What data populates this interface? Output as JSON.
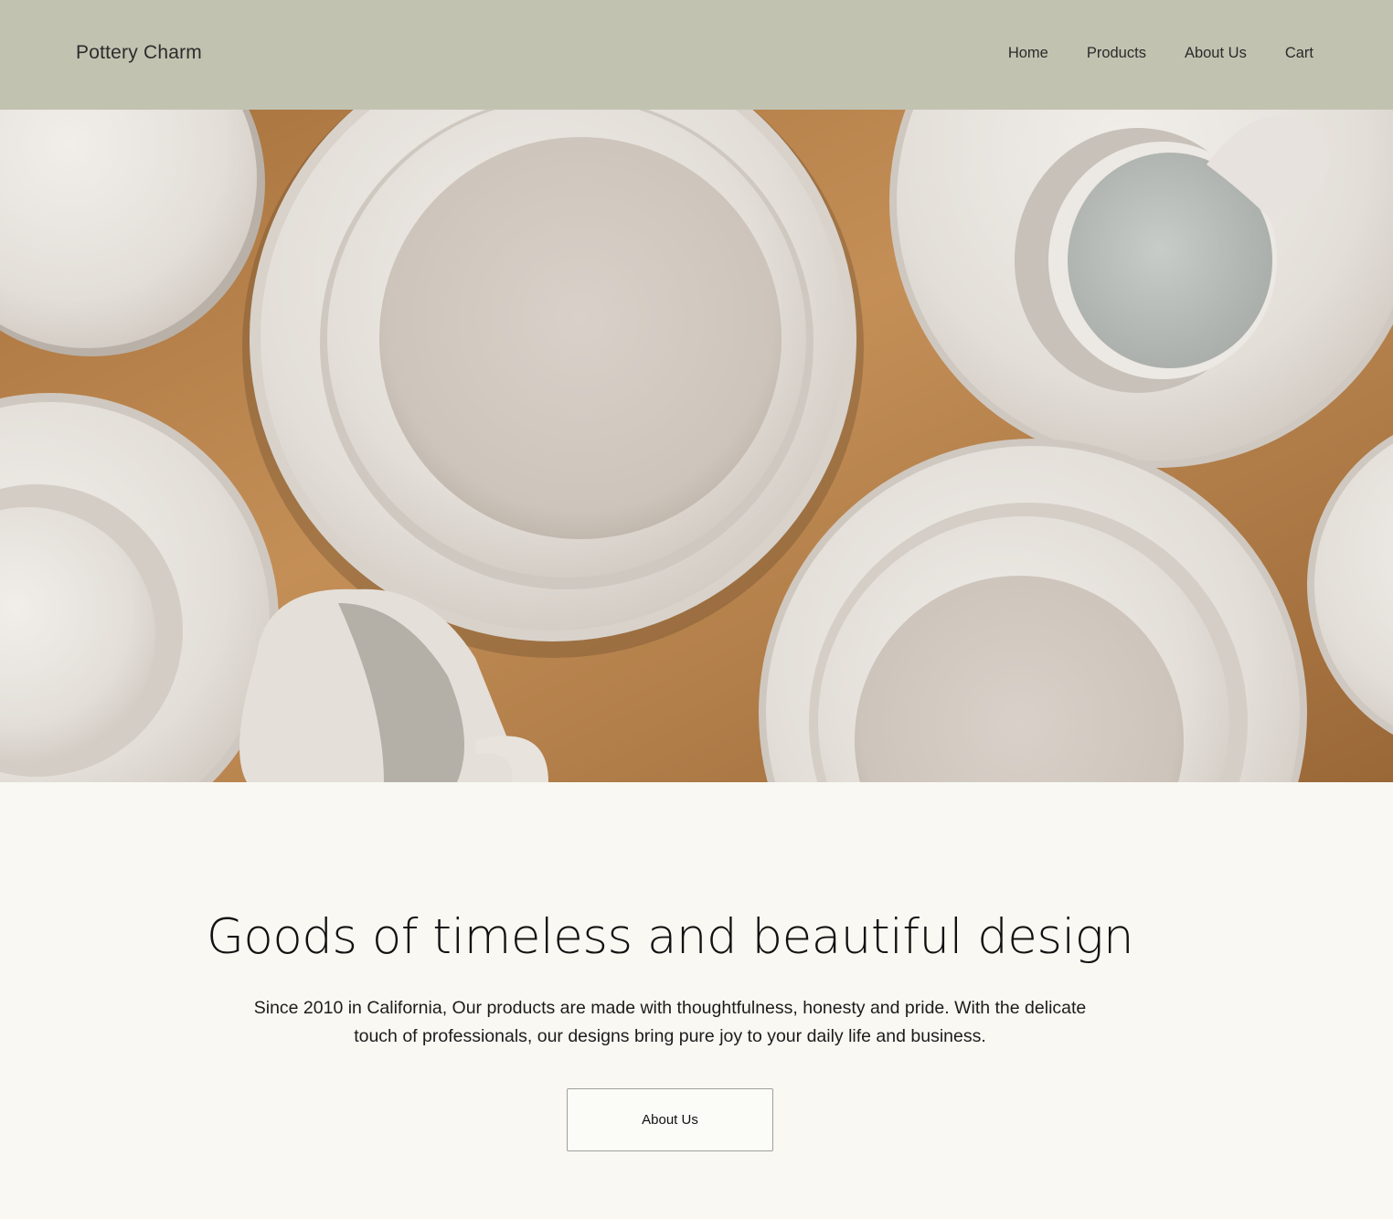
{
  "header": {
    "brand": "Pottery Charm",
    "nav": [
      {
        "label": "Home"
      },
      {
        "label": "Products"
      },
      {
        "label": "About Us"
      },
      {
        "label": "Cart"
      }
    ]
  },
  "hero": {
    "image": "ceramic-plates-cups-photo"
  },
  "intro": {
    "headline": "Goods of timeless and beautiful design",
    "body": "Since 2010 in California, Our products are made with thoughtfulness, honesty and pride. With the delicate touch of professionals, our designs bring pure joy to your daily life and business.",
    "cta_label": "About Us"
  },
  "colors": {
    "header_bg": "#c2c2b1",
    "page_bg": "#f9f8f2",
    "table_wood": "#b07b45",
    "ceramic": "#e6e1db"
  }
}
